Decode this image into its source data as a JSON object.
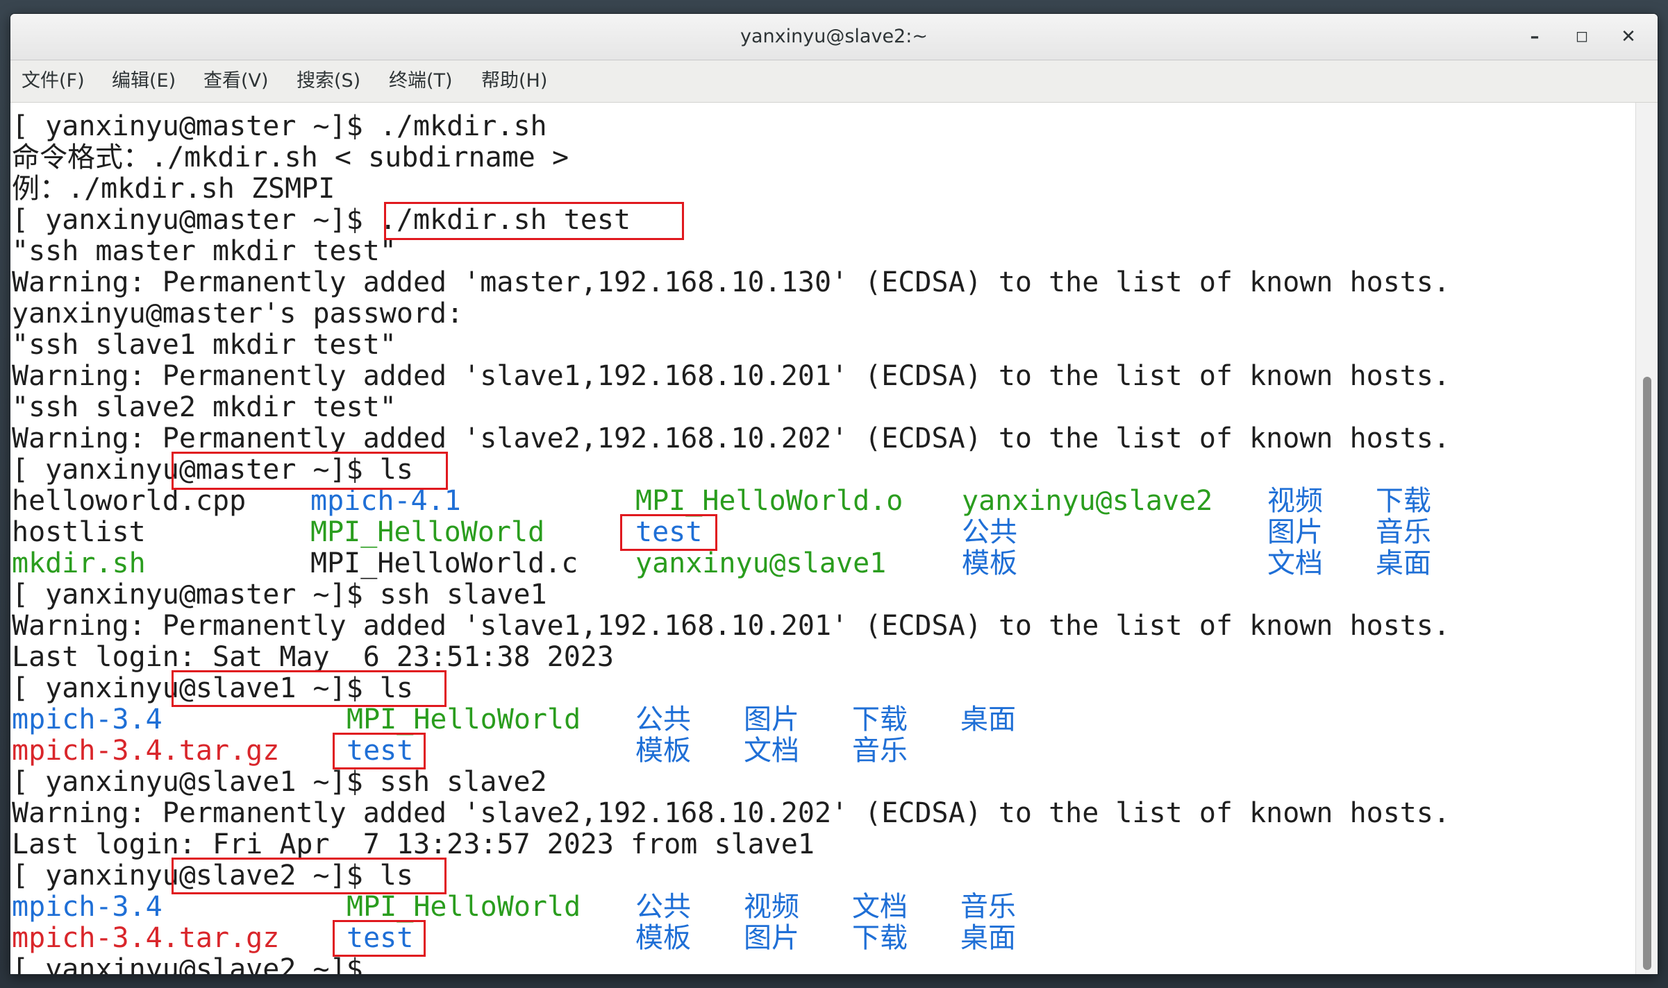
{
  "window": {
    "title": "yanxinyu@slave2:~",
    "minimize_glyph": "–",
    "maximize_glyph": "◻",
    "close_glyph": "✕"
  },
  "menubar": {
    "items": [
      "文件(F)",
      "编辑(E)",
      "查看(V)",
      "搜索(S)",
      "终端(T)",
      "帮助(H)"
    ]
  },
  "terminal": {
    "lines": {
      "l0": "[ yanxinyu@master ~]$ ./mkdir.sh",
      "l1": "命令格式：./mkdir.sh < subdirname >",
      "l2": "例：./mkdir.sh ZSMPI",
      "l3": "[ yanxinyu@master ~]$ ./mkdir.sh test",
      "l4": "\"ssh master mkdir test\"",
      "l5": "Warning: Permanently added 'master,192.168.10.130' (ECDSA) to the list of known hosts.",
      "l6": "yanxinyu@master's password:",
      "l7": "\"ssh slave1 mkdir test\"",
      "l8": "Warning: Permanently added 'slave1,192.168.10.201' (ECDSA) to the list of known hosts.",
      "l9": "\"ssh slave2 mkdir test\"",
      "l10": "Warning: Permanently added 'slave2,192.168.10.202' (ECDSA) to the list of known hosts.",
      "l11": "[ yanxinyu@master ~]$ ls",
      "l15": "[ yanxinyu@master ~]$ ssh slave1",
      "l16": "Warning: Permanently added 'slave1,192.168.10.201' (ECDSA) to the list of known hosts.",
      "l17": "Last login: Sat May  6 23:51:38 2023",
      "l18": "[ yanxinyu@slave1 ~]$ ls",
      "l21": "[ yanxinyu@slave1 ~]$ ssh slave2",
      "l22": "Warning: Permanently added 'slave2,192.168.10.202' (ECDSA) to the list of known hosts.",
      "l23": "Last login: Fri Apr  7 13:23:57 2023 from slave1",
      "l24": "[ yanxinyu@slave2 ~]$ ls",
      "l27": "[ yanxinyu@slave2 ~]$"
    },
    "ls_master": [
      [
        "helloworld.cpp",
        "mpich-4.1",
        "MPI_HelloWorld.o",
        "yanxinyu@slave2",
        "视频",
        "下载"
      ],
      [
        "hostlist",
        "MPI_HelloWorld",
        "test",
        "公共",
        "图片",
        "音乐"
      ],
      [
        "mkdir.sh",
        "MPI_HelloWorld.c",
        "yanxinyu@slave1",
        "模板",
        "文档",
        "桌面"
      ]
    ],
    "ls_slave1": [
      [
        "mpich-3.4",
        "MPI_HelloWorld",
        "公共",
        "图片",
        "下载",
        "桌面"
      ],
      [
        "mpich-3.4.tar.gz",
        "test",
        "模板",
        "文档",
        "音乐"
      ]
    ],
    "ls_slave2": [
      [
        "mpich-3.4",
        "MPI_HelloWorld",
        "公共",
        "视频",
        "文档",
        "音乐"
      ],
      [
        "mpich-3.4.tar.gz",
        "test",
        "模板",
        "图片",
        "下载",
        "桌面"
      ]
    ]
  },
  "colors": {
    "directory": "#1f6fd6",
    "executable": "#2a9d1e",
    "archive": "#d9262b",
    "highlight_box": "#e0191f"
  }
}
